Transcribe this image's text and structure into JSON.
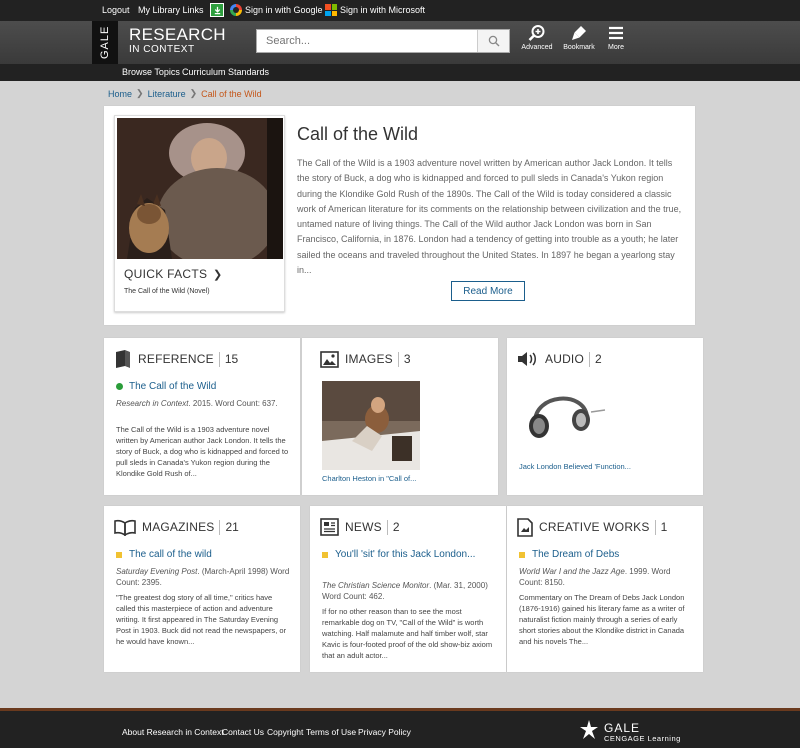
{
  "topbar": {
    "logout": "Logout",
    "my_library_links": "My Library Links",
    "google_signin": "Sign in with Google",
    "microsoft_signin": "Sign in with Microsoft"
  },
  "header": {
    "gale_tab": "GALE",
    "brand_line1": "RESEARCH",
    "brand_line2": "IN CONTEXT",
    "search_placeholder": "Search...",
    "advanced": "Advanced",
    "bookmark": "Bookmark",
    "more": "More"
  },
  "subnav": {
    "browse_topics": "Browse Topics",
    "curriculum_standards": "Curriculum Standards"
  },
  "breadcrumb": {
    "items": [
      "Home",
      "Literature",
      "Call of the Wild"
    ]
  },
  "overview": {
    "title": "Call of the Wild",
    "quick_facts": "QUICK FACTS",
    "quick_facts_sub": "The Call of the Wild (Novel)",
    "text": "The Call of the Wild is a 1903 adventure novel written by American author Jack London. It tells the story of Buck, a dog who is kidnapped and forced to pull sleds in Canada's Yukon region during the Klondike Gold Rush of the 1890s. The Call of the Wild is today considered a classic work of American literature for its comments on the relationship between civilization and the true, untamed nature of living things. The Call of the Wild author Jack London was born in San Francisco, California, in 1876. London had a tendency of getting into trouble as a youth; he later sailed the oceans and traveled throughout the United States. In 1897 he began a yearlong stay in...",
    "read_more": "Read More"
  },
  "cards": {
    "reference": {
      "title": "REFERENCE",
      "count": "15",
      "item_title": "The Call of the Wild",
      "source": "Research in Context",
      "meta_rest": ". 2015.  Word Count: 637.",
      "snippet": "The Call of the Wild is a 1903 adventure novel written by American author Jack London. It tells the story of Buck, a dog who is kidnapped and forced to pull sleds in Canada's Yukon region during the Klondike Gold Rush of..."
    },
    "images": {
      "title": "IMAGES",
      "count": "3",
      "caption": "Charlton Heston in \"Call of..."
    },
    "audio": {
      "title": "AUDIO",
      "count": "2",
      "caption": "Jack London Believed 'Function..."
    },
    "magazines": {
      "title": "MAGAZINES",
      "count": "21",
      "item_title": "The call of the wild",
      "source": "Saturday Evening Post",
      "meta_rest": ". (March-April 1998)  Word Count: 2395.",
      "snippet": "\"The greatest dog story of all time,\" critics have called this masterpiece of action and adventure writing. It first appeared in The Saturday Evening Post in 1903. Buck did not read the newspapers, or he would have known..."
    },
    "news": {
      "title": "NEWS",
      "count": "2",
      "item_title": "You'll 'sit' for this Jack London...",
      "source": "The Christian Science Monitor",
      "meta_rest": ". (Mar. 31, 2000)  Word Count: 462.",
      "snippet": "If for no other reason than to see the most remarkable dog on TV, \"Call of the Wild\" is worth watching. Half malamute and half timber wolf, star Kavic is four-footed proof of the old show-biz axiom that an adult actor..."
    },
    "creative": {
      "title": "CREATIVE WORKS",
      "count": "1",
      "item_title": "The Dream of Debs",
      "source": "World War I and the Jazz Age",
      "meta_rest": ".  1999.  Word Count: 8150.",
      "snippet": "Commentary on The Dream of Debs Jack London (1876-1916) gained his literary fame as a writer of naturalist fiction mainly through a series of early short stories about the Klondike district in Canada and his novels The..."
    }
  },
  "footer": {
    "about": "About Research in Context",
    "contact": "Contact Us",
    "copyright": "Copyright",
    "terms": "Terms of Use",
    "privacy": "Privacy Policy",
    "logo_line1": "GALE",
    "logo_line2": "CENGAGE Learning"
  },
  "colors": {
    "link": "#1b5e8c",
    "breadcrumb_current": "#c4571a",
    "green_bullet": "#2a9d3a",
    "yellow_bullet": "#f1c232",
    "bar_dark": "#222222"
  }
}
